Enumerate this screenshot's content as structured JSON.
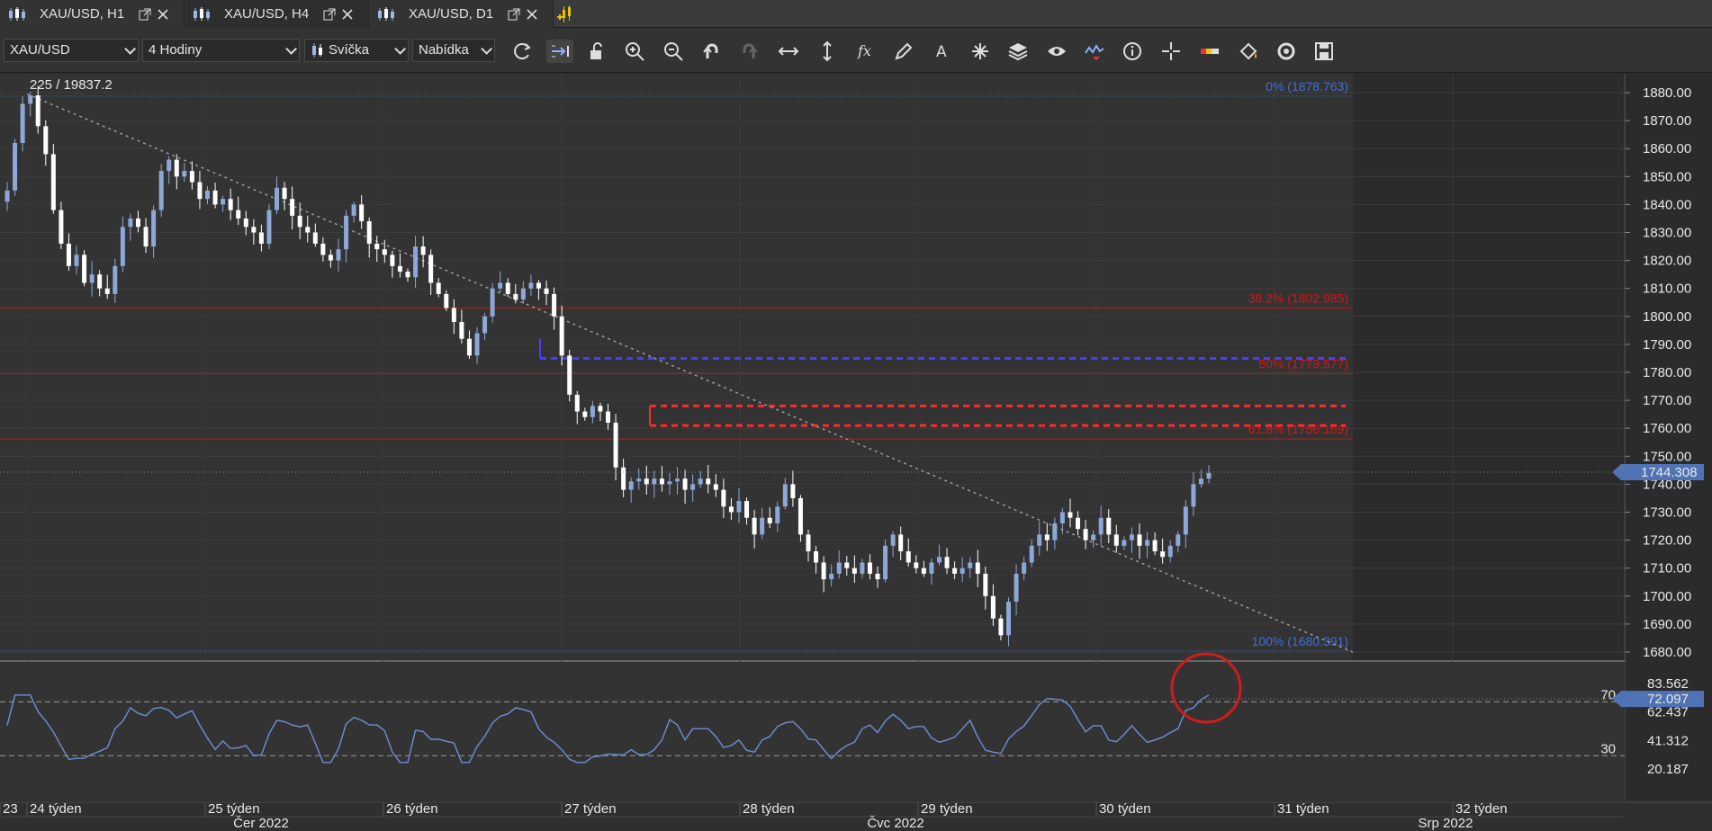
{
  "tabs": [
    {
      "label": "XAU/USD, H1",
      "active": false
    },
    {
      "label": "XAU/USD, H4",
      "active": true
    },
    {
      "label": "XAU/USD, D1",
      "active": false
    }
  ],
  "toolbar": {
    "symbol": "XAU/USD",
    "timeframe": "4 Hodiny",
    "chart_type": "Svíčka",
    "price_side": "Nabídka",
    "icons": [
      "refresh-icon",
      "autoscroll-icon",
      "unlock-icon",
      "zoom-in-icon",
      "zoom-out-icon",
      "undo-icon",
      "redo-icon",
      "horizontal-expand-icon",
      "vertical-expand-icon",
      "indicator-fx-icon",
      "pencil-icon",
      "text-tool-icon",
      "crosshair-star-icon",
      "layers-icon",
      "eye-icon",
      "signal-icon",
      "info-icon",
      "cursor-icon",
      "color-bar-icon",
      "paint-bucket-icon",
      "cycle-icon",
      "save-icon"
    ]
  },
  "chart": {
    "info_label": "225 / 19837.2",
    "current_price_label": "1744.308",
    "price_ticks": [
      "1880.00",
      "1870.00",
      "1860.00",
      "1850.00",
      "1840.00",
      "1830.00",
      "1820.00",
      "1810.00",
      "1800.00",
      "1790.00",
      "1780.00",
      "1770.00",
      "1760.00",
      "1750.00",
      "1740.00",
      "1730.00",
      "1720.00",
      "1710.00",
      "1700.00",
      "1690.00",
      "1680.00"
    ],
    "fib_levels": [
      {
        "label": "0% (1878.763)",
        "price": 1878.763,
        "color": "#3f6fd8"
      },
      {
        "label": "38.2% (1802.985)",
        "price": 1802.985,
        "color": "#d01818"
      },
      {
        "label": "50% (1779.577)",
        "price": 1779.577,
        "color": "#d01818"
      },
      {
        "label": "61.8% (1756.169)",
        "price": 1756.169,
        "color": "#d01818"
      },
      {
        "label": "100% (1680.391)",
        "price": 1680.391,
        "color": "#3f6fd8"
      }
    ],
    "hlines": [
      {
        "price": 1785,
        "color": "#4a3cff"
      },
      {
        "price": 1768,
        "color": "#ff2a2a"
      },
      {
        "price": 1761,
        "color": "#ff2a2a"
      }
    ],
    "rsi": {
      "ticks": [
        "83.562",
        "62.437",
        "41.312",
        "20.187"
      ],
      "current_label": "72.097",
      "level_high": "70",
      "level_low": "30"
    },
    "week_labels": [
      "23",
      "24 týden",
      "25 týden",
      "26 týden",
      "27 týden",
      "28 týden",
      "29 týden",
      "30 týden",
      "31 týden",
      "32 týden"
    ],
    "month_labels": [
      "Čer 2022",
      "Čvc 2022",
      "Srp 2022"
    ]
  },
  "chart_data": {
    "type": "candlestick",
    "title": "",
    "xlabel": "",
    "ylabel": "",
    "ylim": [
      1677,
      1884
    ],
    "series": [
      {
        "values": [
          1845,
          1862,
          1876,
          1879,
          1868,
          1858,
          1838,
          1826,
          1818,
          1822,
          1812,
          1815,
          1810,
          1808,
          1818,
          1832,
          1835,
          1832,
          1825,
          1838,
          1852,
          1856,
          1850,
          1852,
          1848,
          1842,
          1845,
          1840,
          1842,
          1838,
          1835,
          1832,
          1830,
          1826,
          1838,
          1846,
          1842,
          1836,
          1832,
          1830,
          1826,
          1822,
          1820,
          1824,
          1836,
          1840,
          1834,
          1826,
          1824,
          1822,
          1818,
          1816,
          1814,
          1825,
          1822,
          1812,
          1808,
          1803,
          1798,
          1792,
          1786,
          1794,
          1800,
          1810,
          1812,
          1808,
          1806,
          1810,
          1812,
          1810,
          1808,
          1800,
          1786,
          1772,
          1766,
          1764,
          1768,
          1766,
          1762,
          1746,
          1738,
          1741,
          1742,
          1740,
          1742,
          1740,
          1741,
          1742,
          1738,
          1740,
          1742,
          1740,
          1738,
          1732,
          1730,
          1734,
          1728,
          1722,
          1728,
          1726,
          1732,
          1740,
          1735,
          1722,
          1716,
          1712,
          1706,
          1708,
          1712,
          1710,
          1708,
          1712,
          1708,
          1706,
          1718,
          1722,
          1716,
          1712,
          1710,
          1708,
          1712,
          1714,
          1710,
          1708,
          1710,
          1712,
          1708,
          1700,
          1692,
          1686,
          1698,
          1708,
          1712,
          1718,
          1722,
          1720,
          1726,
          1730,
          1728,
          1724,
          1720,
          1722,
          1728,
          1722,
          1718,
          1720,
          1722,
          1718,
          1720,
          1716,
          1714,
          1718,
          1722,
          1732,
          1740,
          1742,
          1744
        ]
      }
    ]
  }
}
